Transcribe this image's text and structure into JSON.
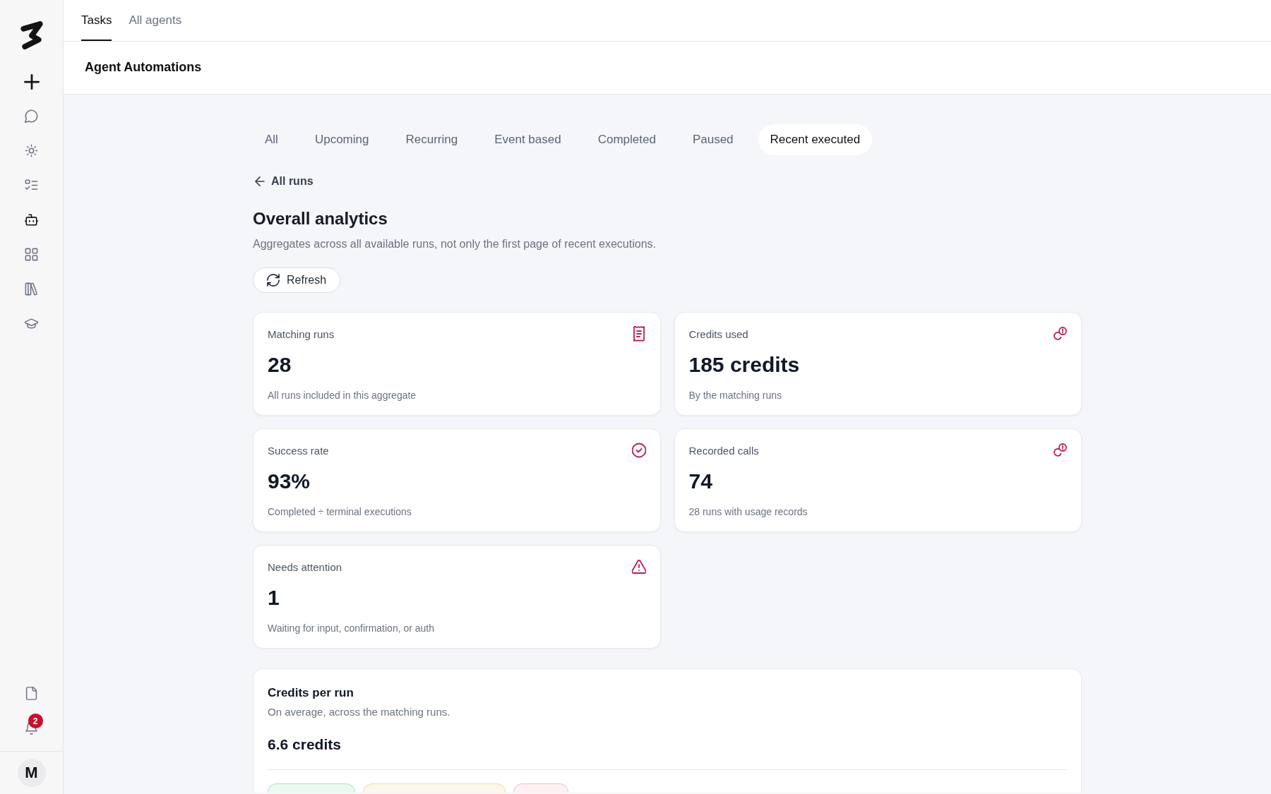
{
  "sidebar": {
    "nav_items": [
      {
        "selected": false
      },
      {
        "selected": false
      },
      {
        "selected": false
      },
      {
        "selected": true
      },
      {
        "selected": false
      },
      {
        "selected": false
      },
      {
        "selected": false
      }
    ],
    "notification_count": "2",
    "avatar_initial": "M"
  },
  "top_tabs": [
    {
      "label": "Tasks",
      "selected": true
    },
    {
      "label": "All agents",
      "selected": false
    }
  ],
  "page_title": "Agent Automations",
  "filter_tabs": [
    {
      "label": "All",
      "selected": false
    },
    {
      "label": "Upcoming",
      "selected": false
    },
    {
      "label": "Recurring",
      "selected": false
    },
    {
      "label": "Event based",
      "selected": false
    },
    {
      "label": "Completed",
      "selected": false
    },
    {
      "label": "Paused",
      "selected": false
    },
    {
      "label": "Recent executed",
      "selected": true
    }
  ],
  "back_link": "All runs",
  "analytics": {
    "title": "Overall analytics",
    "description": "Aggregates across all available runs, not only the first page of recent executions.",
    "refresh_button": "Refresh",
    "metrics": [
      {
        "label": "Matching runs",
        "value": "28",
        "note": "All runs included in this aggregate"
      },
      {
        "label": "Credits used",
        "value": "185 credits",
        "note": "By the matching runs"
      },
      {
        "label": "Success rate",
        "value": "93%",
        "note": "Completed ÷ terminal executions"
      },
      {
        "label": "Recorded calls",
        "value": "74",
        "note": "28 runs with usage records"
      },
      {
        "label": "Needs attention",
        "value": "1",
        "note": "Waiting for input, confirmation, or auth"
      }
    ]
  },
  "credits_per_run": {
    "title": "Credits per run",
    "description": "On average, across the matching runs.",
    "value": "6.6 credits",
    "status_tags": [
      {
        "color": "#a9e4c8"
      },
      {
        "color": "#f5dc9c"
      },
      {
        "color": "#f5c0cb"
      }
    ]
  }
}
